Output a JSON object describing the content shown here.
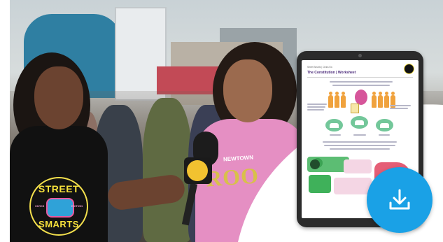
{
  "hero": {
    "shirt_word": "ROO",
    "shirt_small": "NEWTOWN"
  },
  "logo": {
    "top": "STREET",
    "bottom": "SMARTS",
    "side_left": "CIVICS",
    "side_right": "EDITION"
  },
  "worksheet": {
    "small": "Street Smarts | Civics Ed.",
    "title": "The Constitution | Worksheet"
  },
  "download": {
    "icon": "download-icon"
  },
  "colors": {
    "accent": "#1aa1e6",
    "brand_yellow": "#f7e13b",
    "title_purple": "#4b2a7a"
  }
}
